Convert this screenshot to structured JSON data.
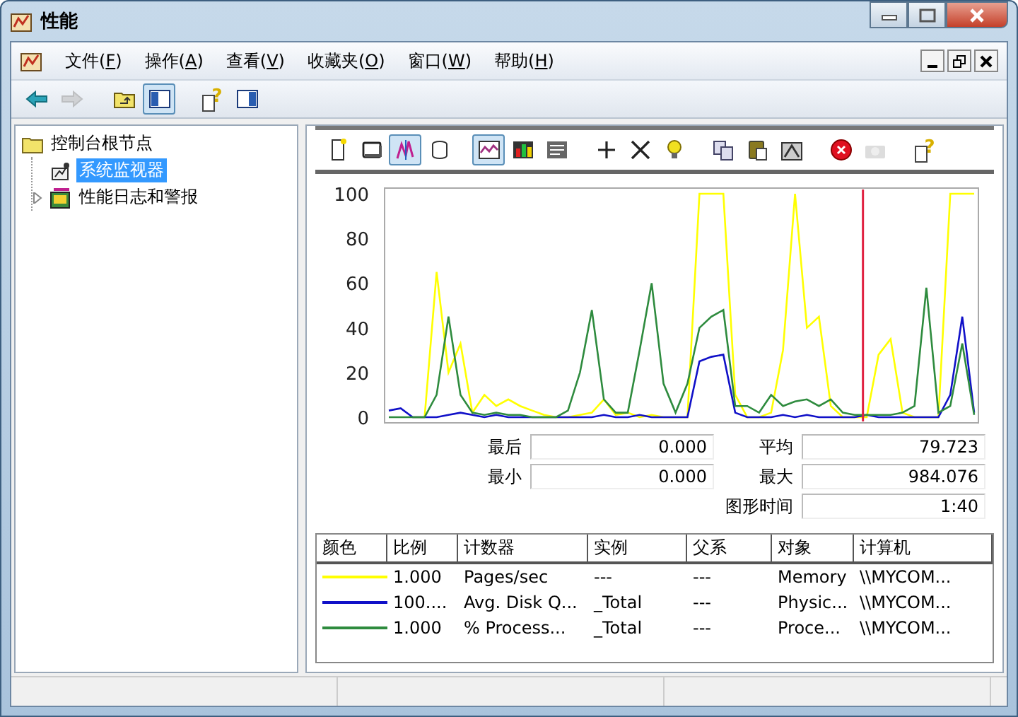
{
  "window": {
    "title": "性能"
  },
  "menu": [
    {
      "label": "文件(",
      "key": "F",
      "end": ")"
    },
    {
      "label": "操作(",
      "key": "A",
      "end": ")"
    },
    {
      "label": "查看(",
      "key": "V",
      "end": ")"
    },
    {
      "label": "收藏夹(",
      "key": "O",
      "end": ")"
    },
    {
      "label": "窗口(",
      "key": "W",
      "end": ")"
    },
    {
      "label": "帮助(",
      "key": "H",
      "end": ")"
    }
  ],
  "toolbar": [
    {
      "kind": "back",
      "selected": false,
      "disabled": false
    },
    {
      "kind": "forward",
      "selected": false,
      "disabled": true
    },
    {
      "kind": "sep"
    },
    {
      "kind": "up",
      "selected": false,
      "disabled": false
    },
    {
      "kind": "tree",
      "selected": true,
      "disabled": false
    },
    {
      "kind": "sep"
    },
    {
      "kind": "help",
      "glyph": "?",
      "selected": false,
      "disabled": false
    },
    {
      "kind": "pane",
      "selected": false,
      "disabled": false
    }
  ],
  "tree": [
    {
      "label": "控制台根节点",
      "selected": false,
      "children": [
        {
          "label": "系统监视器",
          "selected": true
        },
        {
          "label": "性能日志和警报",
          "selected": false,
          "expanded": false
        }
      ]
    }
  ],
  "graph": {
    "toolbar": [
      {
        "kind": "new",
        "selected": false,
        "disabled": false
      },
      {
        "kind": "clear",
        "selected": false,
        "disabled": false
      },
      {
        "kind": "current",
        "selected": true,
        "disabled": false
      },
      {
        "kind": "logdata",
        "selected": false,
        "disabled": false
      },
      {
        "kind": "sep"
      },
      {
        "kind": "graph",
        "selected": true,
        "disabled": false
      },
      {
        "kind": "histogram",
        "selected": false,
        "disabled": false
      },
      {
        "kind": "report",
        "selected": false,
        "disabled": false
      },
      {
        "kind": "sep"
      },
      {
        "kind": "add",
        "selected": false,
        "disabled": false
      },
      {
        "kind": "delete",
        "selected": false,
        "disabled": false
      },
      {
        "kind": "highlight",
        "selected": false,
        "disabled": false
      },
      {
        "kind": "sep"
      },
      {
        "kind": "copy",
        "selected": false,
        "disabled": false
      },
      {
        "kind": "paste",
        "selected": false,
        "disabled": false
      },
      {
        "kind": "properties",
        "selected": false,
        "disabled": false
      },
      {
        "kind": "sep"
      },
      {
        "kind": "freeze",
        "selected": false,
        "disabled": false
      },
      {
        "kind": "update",
        "selected": false,
        "disabled": true
      },
      {
        "kind": "sep"
      },
      {
        "kind": "help",
        "glyph": "?",
        "selected": false,
        "disabled": false
      }
    ],
    "chart_data": {
      "type": "line",
      "categories": [
        null,
        null,
        null,
        null,
        null,
        null,
        null,
        null,
        null,
        null,
        null,
        null,
        null,
        null,
        null,
        null,
        null,
        null,
        null,
        null,
        null,
        null,
        null,
        null,
        null,
        null,
        null,
        null,
        null,
        null,
        null,
        null,
        null,
        null,
        null,
        null,
        null,
        null,
        null,
        null,
        null,
        null,
        null,
        null,
        null,
        null,
        null,
        null,
        null,
        null
      ],
      "ylim": [
        0,
        100
      ],
      "yticks": [
        0,
        20,
        40,
        60,
        80,
        100
      ],
      "series": [
        {
          "color": "#ffff00",
          "values": [
            null,
            null,
            0,
            0,
            65,
            20,
            33,
            2,
            10,
            5,
            8,
            5,
            3,
            1,
            0,
            0,
            1,
            2,
            8,
            1,
            2,
            0,
            1,
            0,
            0,
            0,
            100,
            100,
            100,
            10,
            0,
            0,
            2,
            30,
            100,
            40,
            45,
            5,
            0,
            0,
            0,
            28,
            35,
            2,
            0,
            0,
            0,
            100,
            100,
            100
          ]
        },
        {
          "color": "#1010c8",
          "values": [
            3,
            4,
            0,
            0,
            0,
            1,
            2,
            1,
            0,
            1,
            0,
            0,
            0,
            0,
            0,
            0,
            0,
            0,
            1,
            0,
            0,
            1,
            0,
            0,
            0,
            0,
            25,
            27,
            28,
            2,
            0,
            0,
            0,
            1,
            0,
            1,
            0,
            0,
            0,
            0,
            1,
            0,
            0,
            0,
            0,
            0,
            0,
            10,
            45,
            2
          ]
        },
        {
          "color": "#2e8b3e",
          "values": [
            0,
            0,
            0,
            0,
            10,
            45,
            10,
            2,
            1,
            2,
            1,
            1,
            0,
            0,
            0,
            3,
            20,
            48,
            8,
            2,
            2,
            30,
            60,
            15,
            2,
            15,
            40,
            45,
            48,
            5,
            5,
            2,
            10,
            5,
            7,
            8,
            5,
            8,
            2,
            1,
            1,
            1,
            1,
            2,
            5,
            58,
            2,
            5,
            33,
            1
          ]
        }
      ]
    },
    "cursor": {
      "level": 0.81
    }
  },
  "stats": [
    {
      "label": "最后",
      "value": "0.000"
    },
    {
      "label": "平均",
      "value": "79.723"
    },
    {
      "label": "最小",
      "value": "0.000"
    },
    {
      "label": "最大",
      "value": "984.076"
    },
    {
      "label": "图形时间",
      "value": "1:40"
    }
  ],
  "legend": {
    "columns": [
      "颜色",
      "比例",
      "计数器",
      "实例",
      "父系",
      "对象",
      "计算机"
    ],
    "rows": [
      {
        "color": "#ffff00",
        "scale": "1.000",
        "counter": "Pages/sec",
        "instance": "---",
        "parent": "---",
        "object": "Memory",
        "computer": "\\\\MYCOM..."
      },
      {
        "color": "#1010c8",
        "scale": "100....",
        "counter": "Avg. Disk Q...",
        "instance": "_Total",
        "parent": "---",
        "object": "Physic...",
        "computer": "\\\\MYCOM..."
      },
      {
        "color": "#2e8b3e",
        "scale": "1.000",
        "counter": "% Process...",
        "instance": "_Total",
        "parent": "---",
        "object": "Proce...",
        "computer": "\\\\MYCOM..."
      }
    ]
  }
}
